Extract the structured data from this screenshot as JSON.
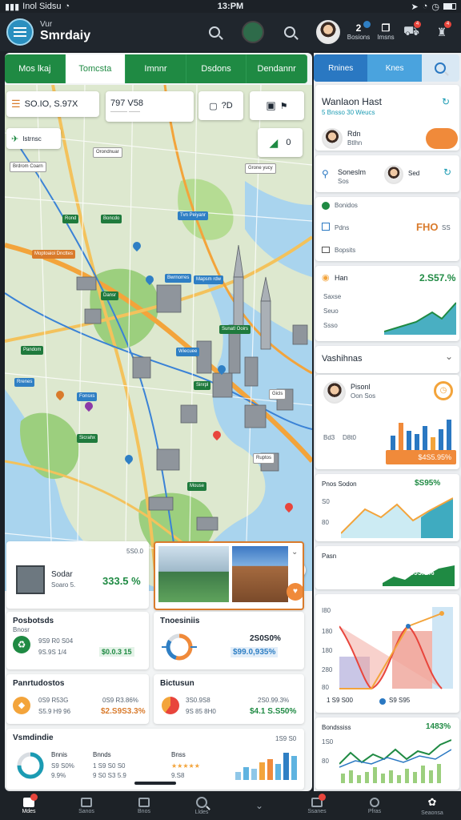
{
  "status": {
    "carrier": "Inol Sidsu",
    "time": "13:PM"
  },
  "app": {
    "subtitle": "Vur",
    "title": "Smrdaiy"
  },
  "header": {
    "stat1_value": "2",
    "stat1_label": "Bosions",
    "stat2_label": "Imsns",
    "badge1": "4",
    "badge2": "4"
  },
  "tabs": [
    "Mos lkaj",
    "Tomcsta",
    "Imnnr",
    "Dsdons",
    "Dendannr"
  ],
  "map": {
    "search1": "SO.IO, S.97X",
    "search2": "797 V58",
    "search2_sub": "——— ——",
    "zoom_label": "?D",
    "filter_label": "Istrnsc",
    "layers_value": "0",
    "labels": [
      "Brdrom Coarn",
      "Orondnuar",
      "Grone yucy",
      "Rond",
      "Boncdo",
      "Tvn Peiyanr",
      "Moptoaioi Dncttes",
      "Bwrnorres",
      "Mapsm rdw",
      "Dansr",
      "Sunatl Ooirs",
      "Pandom",
      "Wiecuee",
      "Rrenes",
      "Fonsxs",
      "Sinrpl",
      "Gicls",
      "Sicrahx",
      "Ruptos",
      "Mouse"
    ]
  },
  "cards": {
    "building": {
      "title": "Sodar",
      "sub": "Soaro 5.",
      "value": "333.5 %",
      "corner": "5S0.0"
    },
    "photos": {},
    "prodlist": {
      "title": "Posbotsds",
      "sub": "Bnosr",
      "l1": "9S9 R0 S04",
      "l2": "9S.9S 1/4",
      "value": "$0.0.3 15"
    },
    "trends": {
      "title": "Tnoesiniis",
      "value": "2S0S0%",
      "value2": "$99.0,935%"
    },
    "routes": {
      "title": "Panrtudostos",
      "l1": "0S9 R53G",
      "l2": "S5.9 H9 96",
      "v1": "0S9 R3.86%",
      "v2": "$2.S9S3.3%"
    },
    "income": {
      "title": "Bictusun",
      "l1": "3S0.9S8",
      "l2": "9S 85 8H0",
      "v1": "2S0.99.3%",
      "v2": "$4.1 S.S50%"
    },
    "overview": {
      "title": "Vsmdindie",
      "corner": "1S9 S0",
      "c1": "Bnnis",
      "c2": "Bnnds",
      "c3": "Bnss",
      "r1": "S9 S0%",
      "r2": "9.9%",
      "r3": "1 S9 S0 S0",
      "r4": "9 S0 S3 5.9",
      "r5": "9.S8"
    }
  },
  "side": {
    "tab1": "Rnines",
    "tab2": "Knes",
    "hotel_title": "Wanlaon Hast",
    "hotel_sub": "5 Bnsso 30 Weucs",
    "person1": "Rdn",
    "person1_sub": "Btlhn",
    "search_title": "Soneslm",
    "search_sub": "Sos",
    "search_v": "Sed",
    "row1": "Bonidos",
    "row1_v": "",
    "row2": "Pdns",
    "row2_v": "FHO",
    "row2_v2": "SS",
    "row3": "Bopsits",
    "chart1_title": "Han",
    "chart1_value": "2.S57.%",
    "chart1_l1": "Saxse",
    "chart1_l2": "Seuo",
    "chart1_l3": "Ssso",
    "section_title": "Vashihnas",
    "stat_title": "Pisonl",
    "stat_sub": "Oon Sos",
    "bar_l1": "Bd3",
    "bar_l2": "D8t0",
    "bar_v": "$4S5.95%",
    "line_title": "Pnos Sodon",
    "line_value": "$S95%",
    "line_y1": "S0",
    "line_y2": "80",
    "area_title": "Pasn",
    "area_value": "$S95.5%",
    "dist_y": [
      "I80",
      "180",
      "180",
      "280",
      "80"
    ],
    "dist_l1": "1 S9 S00",
    "dist_l2": "S9 S95",
    "last_title": "Bondssiss",
    "last_value": "1483%",
    "last_y1": "1S0",
    "last_y2": "80"
  },
  "bottomnav": [
    "Mdes",
    "Sanos",
    "Bnos",
    "Lldes",
    "",
    "Ssanes",
    "Pfras",
    "Seaonsa"
  ]
}
